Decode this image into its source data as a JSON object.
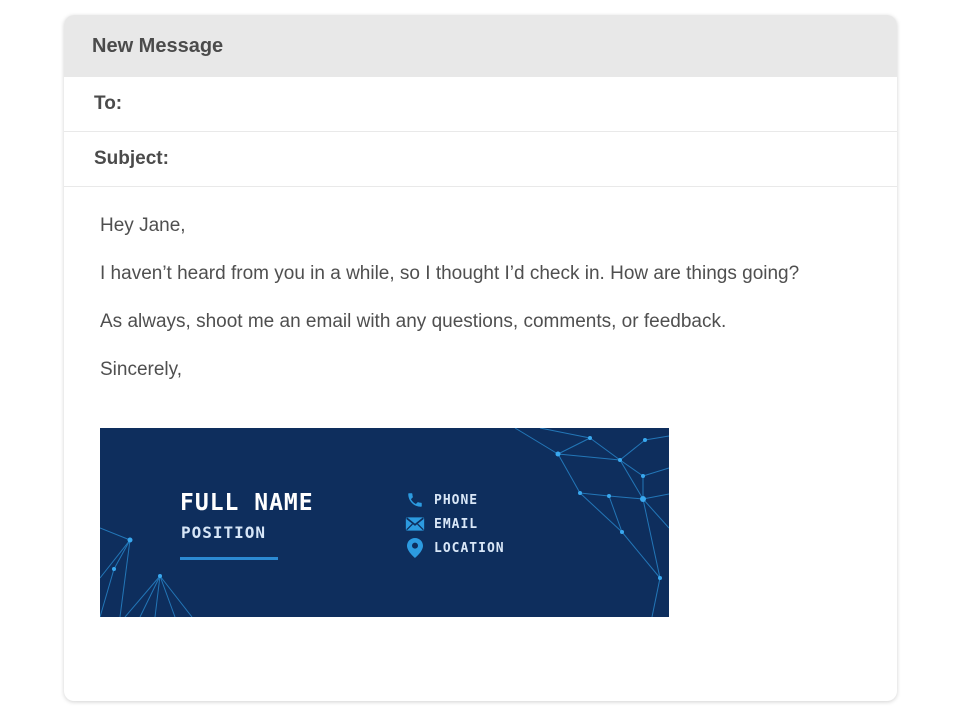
{
  "window": {
    "title": "New Message"
  },
  "fields": {
    "to_label": "To:",
    "to_value": "",
    "subject_label": "Subject:",
    "subject_value": ""
  },
  "body": {
    "greeting": "Hey Jane,",
    "line1": "I haven’t heard from you in a while, so I thought I’d check in. How are things going?",
    "line2": "As always, shoot me an email with any questions, comments, or feedback.",
    "closing": "Sincerely,"
  },
  "signature": {
    "name": "FULL NAME",
    "position": "POSITION",
    "phone": "PHONE",
    "email": "EMAIL",
    "location": "LOCATION",
    "background_color": "#0e2e5d",
    "accent_color": "#2c8ad2",
    "icons": [
      "phone-icon",
      "mail-icon",
      "location-pin-icon"
    ]
  }
}
